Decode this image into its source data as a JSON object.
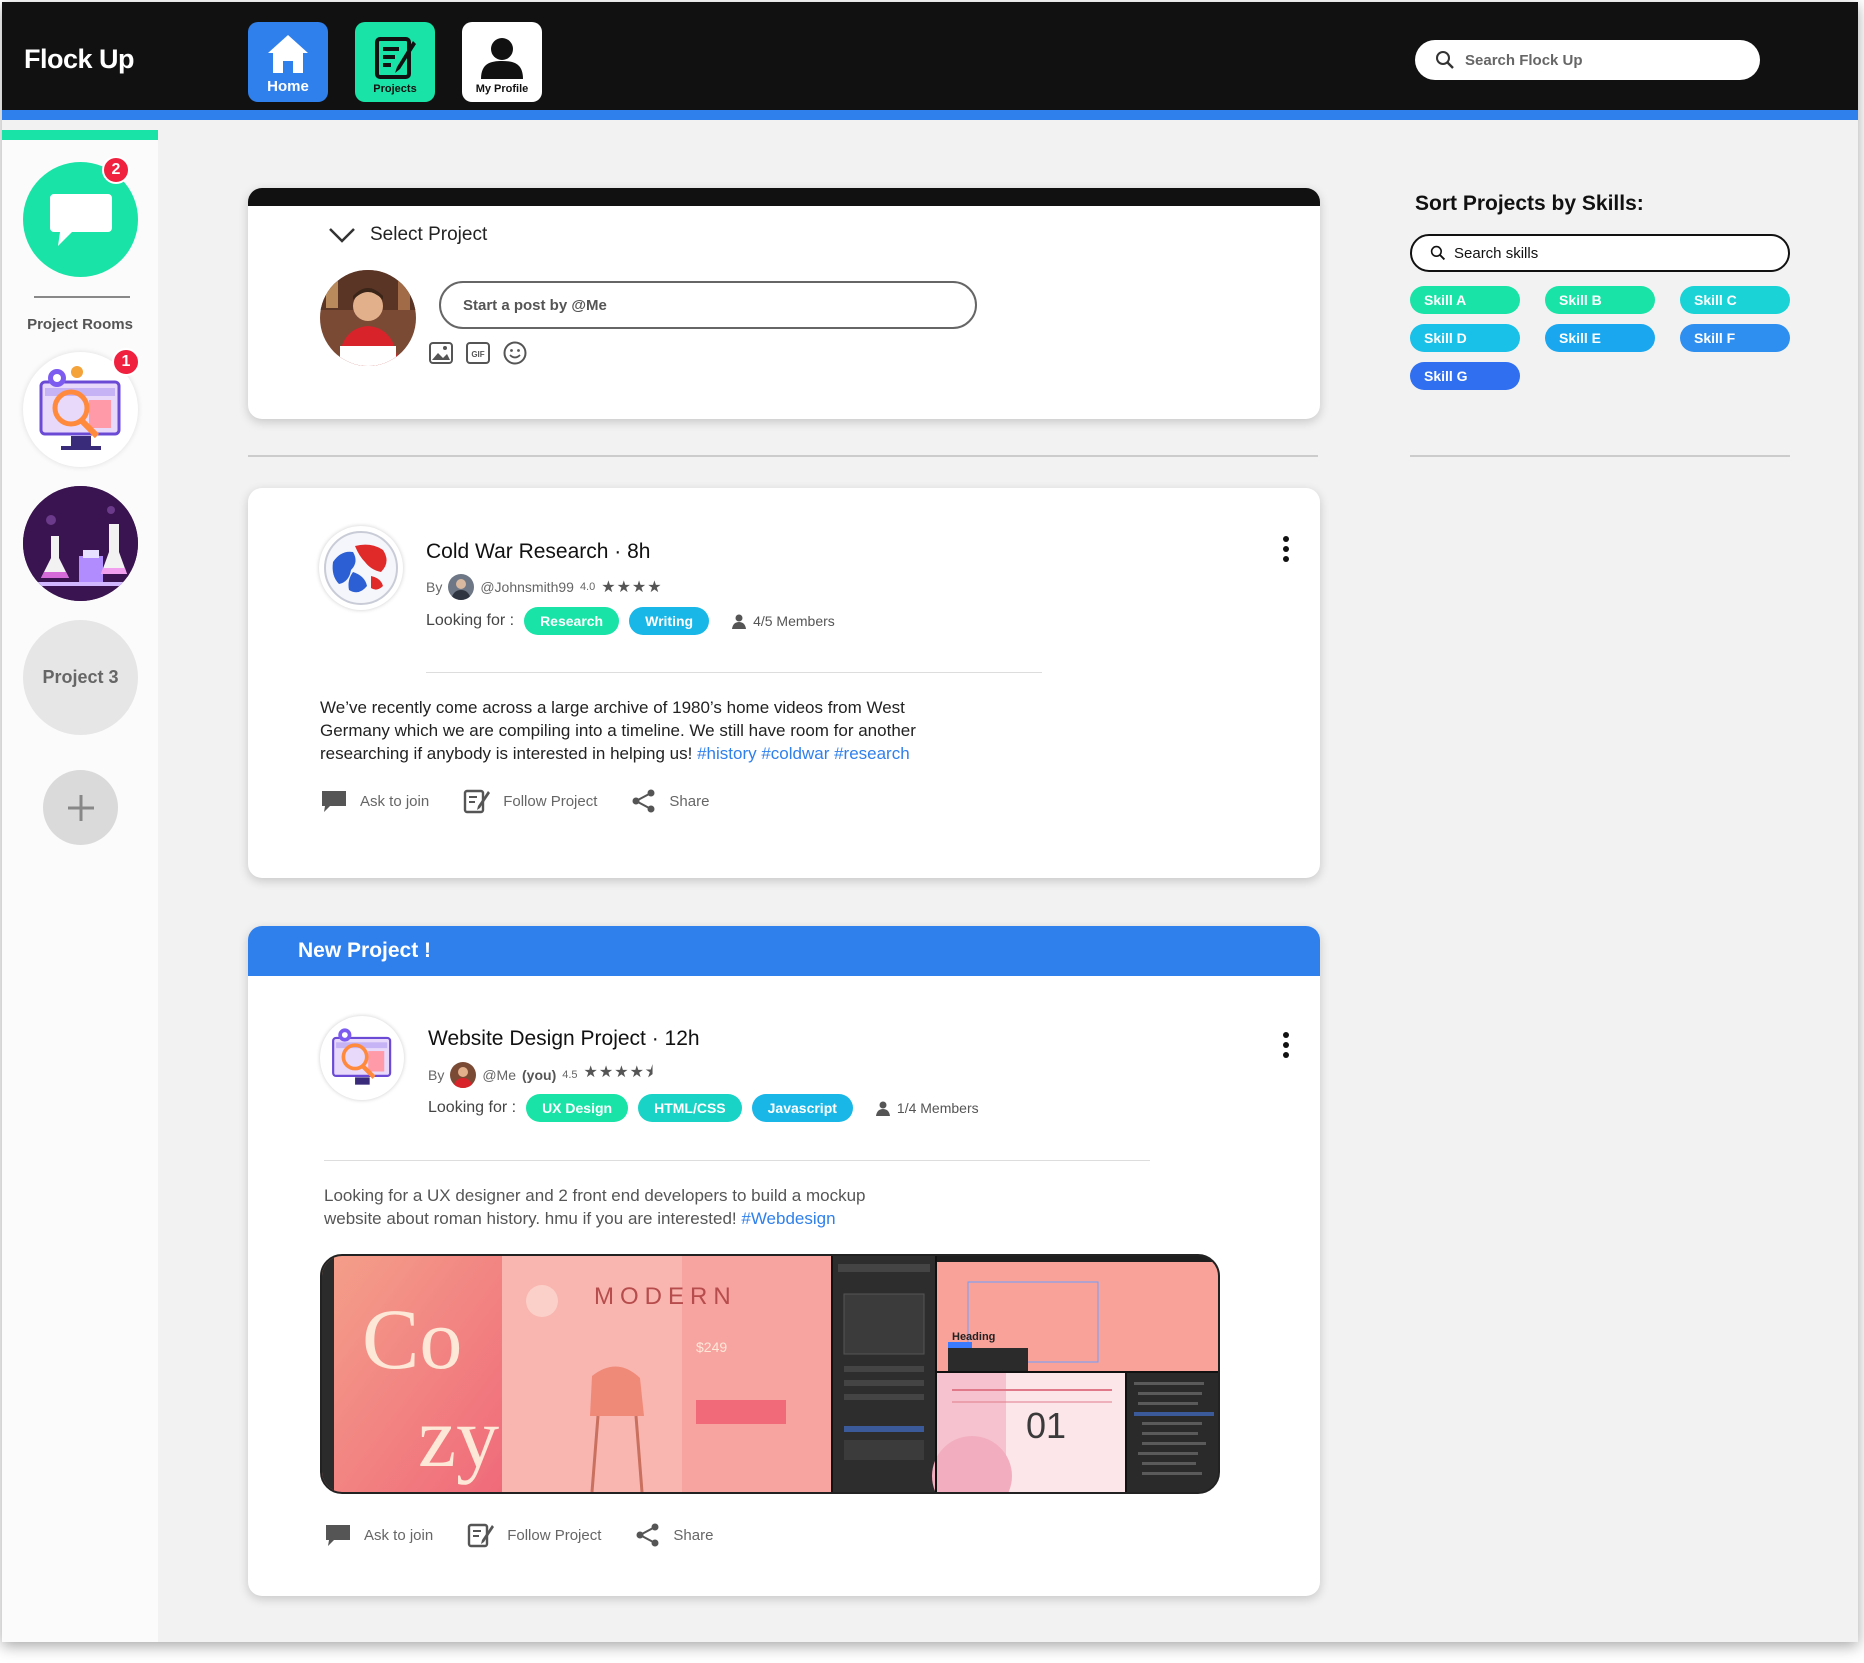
{
  "app": {
    "title": "Flock Up"
  },
  "nav": {
    "home": "Home",
    "projects": "Projects",
    "profile": "My Profile"
  },
  "search": {
    "placeholder": "Search Flock Up"
  },
  "sidebar": {
    "chat_badge": "2",
    "title": "Project Rooms",
    "room1_badge": "1",
    "room3_label": "Project 3"
  },
  "composer": {
    "select_label": "Select Project",
    "placeholder": "Start a post by @Me"
  },
  "skills": {
    "title": "Sort Projects by Skills:",
    "search_placeholder": "Search skills",
    "chips": [
      {
        "label": "Skill A",
        "color": "#19e3a6"
      },
      {
        "label": "Skill B",
        "color": "#19e3a6"
      },
      {
        "label": "Skill C",
        "color": "#19d3d6"
      },
      {
        "label": "Skill D",
        "color": "#19c0e8"
      },
      {
        "label": "Skill E",
        "color": "#1aa7f0"
      },
      {
        "label": "Skill F",
        "color": "#2f8ff0"
      },
      {
        "label": "Skill G",
        "color": "#2f6ff0"
      }
    ]
  },
  "posts": [
    {
      "title": "Cold War Research · 8h",
      "by": "By",
      "author": "@Johnsmith99",
      "rating": "4.0",
      "stars": "★★★★",
      "looking_for": "Looking for :",
      "tags": [
        {
          "label": "Research",
          "color": "#19e3a6"
        },
        {
          "label": "Writing",
          "color": "#19b7e8"
        }
      ],
      "members": "4/5 Members",
      "body": "We’ve recently come across a large archive of 1980’s home videos from West Germany which we are compiling into a timeline. We still have room for another researching if anybody is interested in helping us!",
      "hashtags": "#history #coldwar #research",
      "actions": {
        "ask": "Ask to join",
        "follow": "Follow Project",
        "share": "Share"
      }
    },
    {
      "header": "New Project !",
      "title": "Website Design Project · 12h",
      "by": "By",
      "author": "@Me",
      "author_suffix": "(you)",
      "rating": "4.5",
      "stars": "★★★★⯨",
      "looking_for": "Looking for :",
      "tags": [
        {
          "label": "UX Design",
          "color": "#19e3a6"
        },
        {
          "label": "HTML/CSS",
          "color": "#19d3c6"
        },
        {
          "label": "Javascript",
          "color": "#19b7e8"
        }
      ],
      "members": "1/4 Members",
      "body": "Looking for a UX designer and 2 front end developers to build a mockup website about roman history. hmu if you are interested!",
      "hashtags": "#Webdesign",
      "actions": {
        "ask": "Ask to join",
        "follow": "Follow Project",
        "share": "Share"
      },
      "image_text": {
        "cozy_1": "Co",
        "cozy_2": "zy",
        "modern": "MODERN",
        "price": "$249",
        "number": "01",
        "heading": "Heading"
      }
    }
  ],
  "colors": {
    "accent_blue": "#2f80ed",
    "accent_green": "#19e3a6",
    "badge_red": "#f0213f",
    "topbar": "#111111"
  }
}
